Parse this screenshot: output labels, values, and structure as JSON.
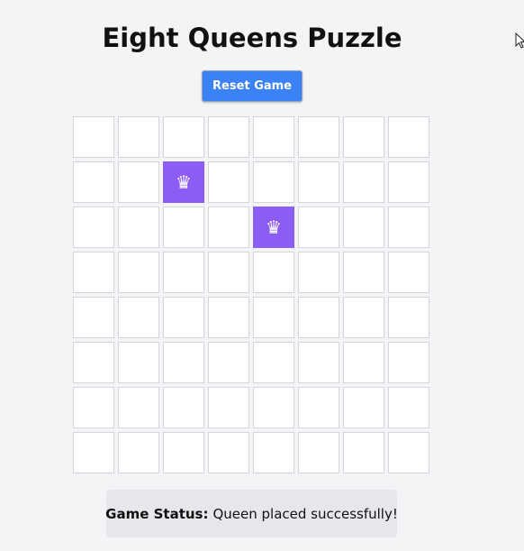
{
  "title": "Eight Queens Puzzle",
  "reset_label": "Reset Game",
  "board": {
    "size": 8,
    "queens": [
      {
        "row": 1,
        "col": 2
      },
      {
        "row": 2,
        "col": 4
      }
    ],
    "queen_glyph": "♛",
    "queen_color": "#8b5cf6",
    "empty_color": "#ffffff"
  },
  "status": {
    "label": "Game Status:",
    "message": "Queen placed successfully!"
  },
  "colors": {
    "accent": "#3b82f6",
    "background": "#f3f4f6"
  }
}
